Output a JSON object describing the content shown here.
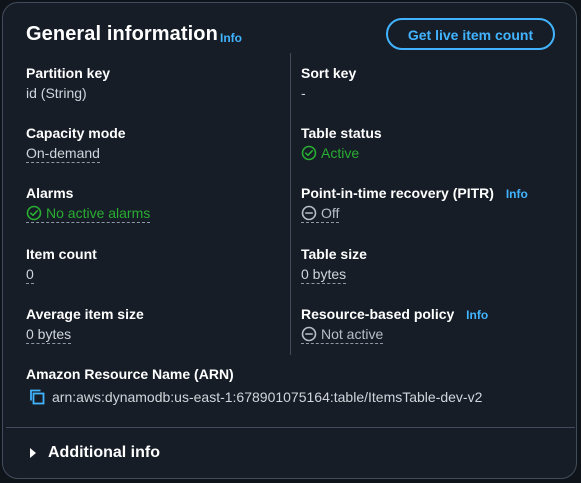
{
  "panel": {
    "title": "General information",
    "title_info": "Info",
    "live_count_button": "Get live item count"
  },
  "left": {
    "partition_key": {
      "label": "Partition key",
      "value": "id (String)"
    },
    "capacity_mode": {
      "label": "Capacity mode",
      "value": "On-demand"
    },
    "alarms": {
      "label": "Alarms",
      "value": "No active alarms"
    },
    "item_count": {
      "label": "Item count",
      "value": "0"
    },
    "avg_item_size": {
      "label": "Average item size",
      "value": "0 bytes"
    }
  },
  "right": {
    "sort_key": {
      "label": "Sort key",
      "value": "-"
    },
    "table_status": {
      "label": "Table status",
      "value": "Active"
    },
    "pitr": {
      "label": "Point-in-time recovery (PITR)",
      "info": "Info",
      "value": "Off"
    },
    "table_size": {
      "label": "Table size",
      "value": "0 bytes"
    },
    "resource_policy": {
      "label": "Resource-based policy",
      "info": "Info",
      "value": "Not active"
    }
  },
  "arn": {
    "label": "Amazon Resource Name (ARN)",
    "value": "arn:aws:dynamodb:us-east-1:678901075164:table/ItemsTable-dev-v2",
    "icon": "copy-icon"
  },
  "additional_info": {
    "label": "Additional info",
    "icon": "caret-right-icon"
  },
  "colors": {
    "background": "#0f141a",
    "panel": "#161d26",
    "accent": "#42b4ff",
    "success": "#29ad32",
    "border": "#414d5c"
  }
}
